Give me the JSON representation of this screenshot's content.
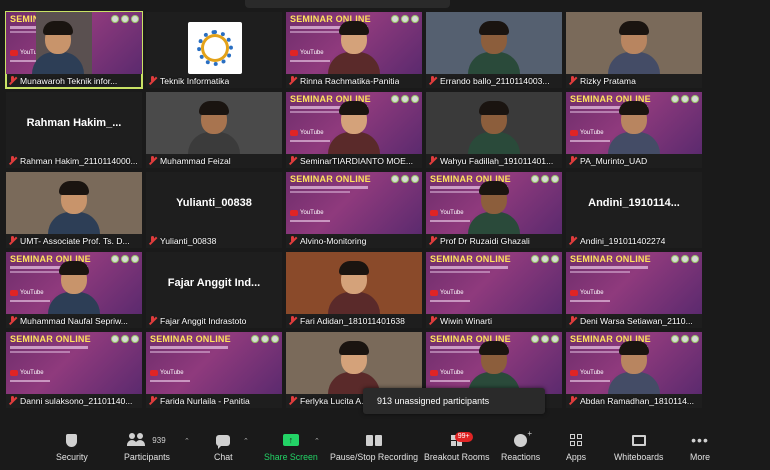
{
  "slide": {
    "title": "SEMINAR ONLINE",
    "youtube": "YouTube"
  },
  "tiles": [
    {
      "name": "Munawaroh Teknik infor...",
      "kind": "slide-self"
    },
    {
      "name": "Teknik Informatika",
      "kind": "logo"
    },
    {
      "name": "Rinna Rachmatika-Panitia",
      "kind": "slide-face"
    },
    {
      "name": "Errando ballo_2110114003...",
      "kind": "video"
    },
    {
      "name": "Rizky Pratama",
      "kind": "video"
    },
    {
      "name": "Rahman Hakim_2110114000...",
      "kind": "text",
      "display": "Rahman  Hakim_..."
    },
    {
      "name": "Muhammad Feizal",
      "kind": "video"
    },
    {
      "name": "SeminarTIARDIANTO MOE...",
      "kind": "slide-face"
    },
    {
      "name": "Wahyu Fadillah_191011401...",
      "kind": "video"
    },
    {
      "name": "PA_Murinto_UAD",
      "kind": "slide-face"
    },
    {
      "name": "UMT- Associate Prof. Ts. D...",
      "kind": "video"
    },
    {
      "name": "Yulianti_00838",
      "kind": "text",
      "display": "Yulianti_00838"
    },
    {
      "name": "Alvino-Monitoring",
      "kind": "slide"
    },
    {
      "name": "Prof Dr Ruzaidi Ghazali",
      "kind": "slide-face"
    },
    {
      "name": "Andini_191011402274",
      "kind": "text",
      "display": "Andini_1910114..."
    },
    {
      "name": "Muhammad Naufal Sepriw...",
      "kind": "slide-face"
    },
    {
      "name": "Fajar Anggit Indrastoto",
      "kind": "text",
      "display": "Fajar  Anggit  Ind..."
    },
    {
      "name": "Fari Adidan_181011401638",
      "kind": "video"
    },
    {
      "name": "Wiwin Winarti",
      "kind": "slide"
    },
    {
      "name": "Deni Warsa Setiawan_2110...",
      "kind": "slide"
    },
    {
      "name": "Danni sulaksono_21101140...",
      "kind": "slide"
    },
    {
      "name": "Farida Nurlaila - Panitia",
      "kind": "slide"
    },
    {
      "name": "Ferlyka Lucita A...",
      "kind": "video"
    },
    {
      "name": "",
      "kind": "slide-face"
    },
    {
      "name": "Abdan Ramadhan_1810114...",
      "kind": "slide-face"
    }
  ],
  "toast": "913 unassigned participants",
  "toolbar": {
    "security": "Security",
    "participants": "Participants",
    "participants_count": "939",
    "chat": "Chat",
    "share": "Share Screen",
    "record": "Pause/Stop Recording",
    "breakout": "Breakout Rooms",
    "breakout_badge": "99+",
    "reactions": "Reactions",
    "apps": "Apps",
    "whiteboards": "Whiteboards",
    "more": "More"
  },
  "colors": {
    "active_border": "#c9e265",
    "share_green": "#23d366",
    "muted_red": "#e03c3c",
    "slide_purple": "#8f3a7d"
  }
}
